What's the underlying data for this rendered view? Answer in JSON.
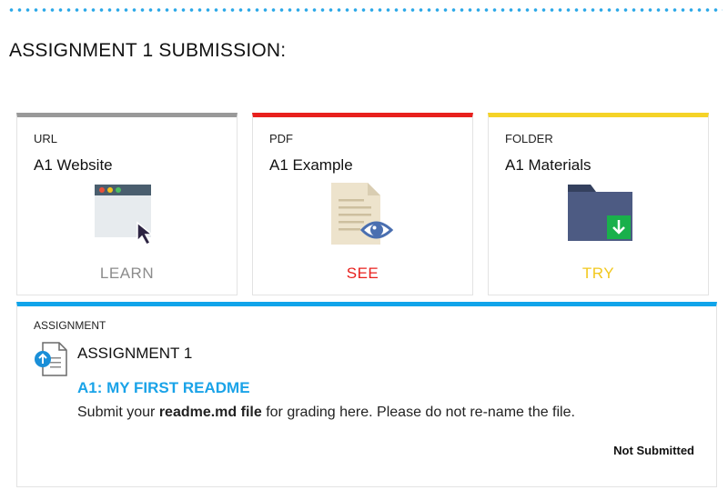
{
  "header": {
    "title": "ASSIGNMENT 1 SUBMISSION:"
  },
  "cards": [
    {
      "type": "URL",
      "name": "A1 Website",
      "action": "LEARN",
      "icon": "browser-window-icon",
      "accent": "#999999",
      "action_color": "#8c8c8c"
    },
    {
      "type": "PDF",
      "name": "A1 Example",
      "action": "SEE",
      "icon": "document-eye-icon",
      "accent": "#e8201d",
      "action_color": "#e8201d"
    },
    {
      "type": "FOLDER",
      "name": "A1 Materials",
      "action": "TRY",
      "icon": "folder-download-icon",
      "accent": "#f5d327",
      "action_color": "#f2c81e"
    }
  ],
  "assignment": {
    "type": "ASSIGNMENT",
    "name": "ASSIGNMENT 1",
    "link": "A1: MY FIRST README",
    "desc_before": "Submit your ",
    "desc_bold": "readme.md file",
    "desc_after": " for grading here. Please do not re-name the file.",
    "status": "Not Submitted",
    "icon": "file-upload-icon",
    "accent": "#10a4ea"
  }
}
